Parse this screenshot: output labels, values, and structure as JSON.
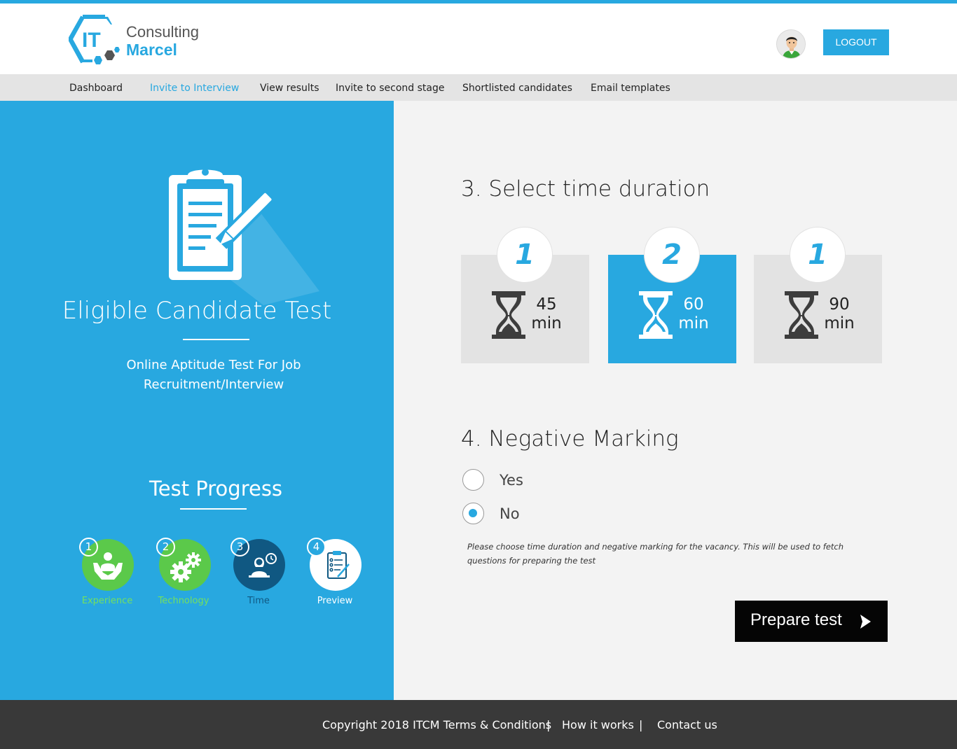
{
  "brand": {
    "line1": "Consulting",
    "line2": "Marcel",
    "mark": "IT"
  },
  "header": {
    "logout_label": "LOGOUT",
    "avatar_icon": "user-avatar-icon"
  },
  "nav": {
    "items": [
      {
        "label": "Dashboard",
        "active": false
      },
      {
        "label": "Invite to Interview",
        "active": true
      },
      {
        "label": "View results",
        "active": false
      },
      {
        "label": "Invite to second stage",
        "active": false
      },
      {
        "label": "Shortlisted candidates",
        "active": false
      },
      {
        "label": "Email templates",
        "active": false
      }
    ]
  },
  "left": {
    "hero_icon": "clipboard-pencil-icon",
    "title": "Eligible Candidate Test",
    "subtitle": "Online Aptitude Test For Job Recruitment/Interview",
    "progress_title": "Test Progress",
    "steps": [
      {
        "num": "1",
        "label": "Experience",
        "icon": "experience-icon",
        "state": "done"
      },
      {
        "num": "2",
        "label": "Technology",
        "icon": "gears-icon",
        "state": "done"
      },
      {
        "num": "3",
        "label": "Time",
        "icon": "time-person-icon",
        "state": "current"
      },
      {
        "num": "4",
        "label": "Preview",
        "icon": "checklist-icon",
        "state": "upcoming"
      }
    ]
  },
  "duration": {
    "title": "3. Select time duration",
    "options": [
      {
        "badge": "1",
        "value": "45",
        "unit": "min",
        "selected": false
      },
      {
        "badge": "2",
        "value": "60",
        "unit": "min",
        "selected": true
      },
      {
        "badge": "1",
        "value": "90",
        "unit": "min",
        "selected": false
      }
    ]
  },
  "negative": {
    "title": "4. Negative Marking",
    "options": [
      {
        "label": "Yes",
        "checked": false
      },
      {
        "label": "No",
        "checked": true
      }
    ],
    "hint": "Please choose time duration and negative marking for the vacancy. This will be used to fetch questions for preparing the test"
  },
  "cta": {
    "label": "Prepare test"
  },
  "footer": {
    "copyright": "Copyright 2018 ITCM Terms & Conditions",
    "sep": "|",
    "how": "How it works",
    "contact": "Contact us"
  },
  "colors": {
    "accent": "#28a8e0",
    "green": "#5bc94a",
    "dark_blue": "#105882",
    "footer": "#393939"
  }
}
